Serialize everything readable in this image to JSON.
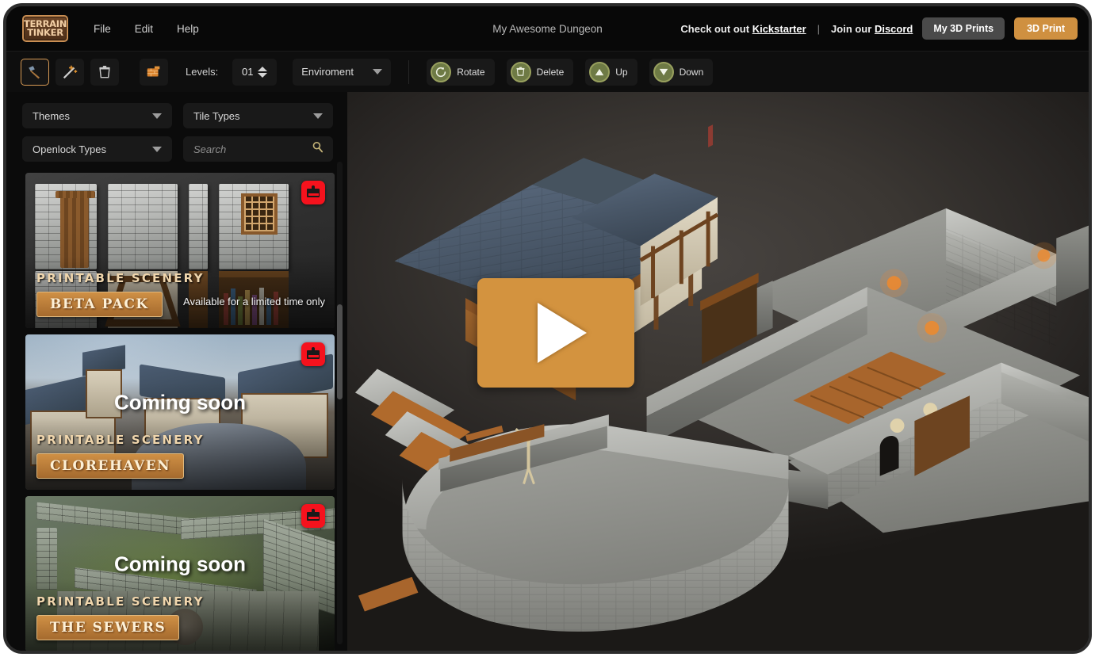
{
  "app": {
    "logo_line1": "TERRAIN",
    "logo_line2": "TINKER",
    "document_title": "My Awesome Dungeon",
    "accent_orange": "#cf9040",
    "olive": "#6e7a45",
    "badge_red": "#f5121d"
  },
  "menu": [
    {
      "label": "File",
      "name": "menu-file"
    },
    {
      "label": "Edit",
      "name": "menu-edit"
    },
    {
      "label": "Help",
      "name": "menu-help"
    }
  ],
  "header_right": {
    "kickstarter_prefix": "Check out out",
    "kickstarter_link": "Kickstarter",
    "separator": "|",
    "discord_prefix": "Join our",
    "discord_link": "Discord",
    "my_prints_label": "My 3D Prints",
    "print_label": "3D Print"
  },
  "toolbar": {
    "tools": [
      {
        "name": "hammer-tool",
        "icon": "hammer-icon",
        "active": true
      },
      {
        "name": "magic-wand-tool",
        "icon": "magic-wand-icon",
        "active": false
      },
      {
        "name": "delete-tool",
        "icon": "trash-icon",
        "active": false
      }
    ],
    "open_tool": {
      "name": "open-project-tool",
      "icon": "folder-bricks-icon"
    },
    "levels_label": "Levels:",
    "levels_value": "01",
    "environment_label": "Enviroment",
    "actions": [
      {
        "label": "Rotate",
        "icon": "rotate-icon",
        "name": "rotate-button"
      },
      {
        "label": "Delete",
        "icon": "trash-icon",
        "name": "delete-button"
      },
      {
        "label": "Up",
        "icon": "triangle-up-icon",
        "name": "up-button"
      },
      {
        "label": "Down",
        "icon": "triangle-down-icon",
        "name": "down-button"
      }
    ]
  },
  "sidebar": {
    "filters": [
      {
        "label": "Themes",
        "name": "themes-dropdown"
      },
      {
        "label": "Tile Types",
        "name": "tile-types-dropdown"
      },
      {
        "label": "Openlock Types",
        "name": "openlock-types-dropdown"
      }
    ],
    "search_placeholder": "Search",
    "search_value": "",
    "cards": [
      {
        "brand": "PRINTABLE SCENERY",
        "title": "BETA PACK",
        "note": "Available for a limited time only",
        "coming_soon": "",
        "badge": "kickstarter-badge"
      },
      {
        "brand": "PRINTABLE SCENERY",
        "title": "CLOREHAVEN",
        "note": "",
        "coming_soon": "Coming soon",
        "badge": "kickstarter-badge"
      },
      {
        "brand": "PRINTABLE SCENERY",
        "title": "THE SEWERS",
        "note": "",
        "coming_soon": "Coming soon",
        "badge": "kickstarter-badge"
      }
    ]
  },
  "viewport": {
    "play_button_name": "play-video-button"
  }
}
